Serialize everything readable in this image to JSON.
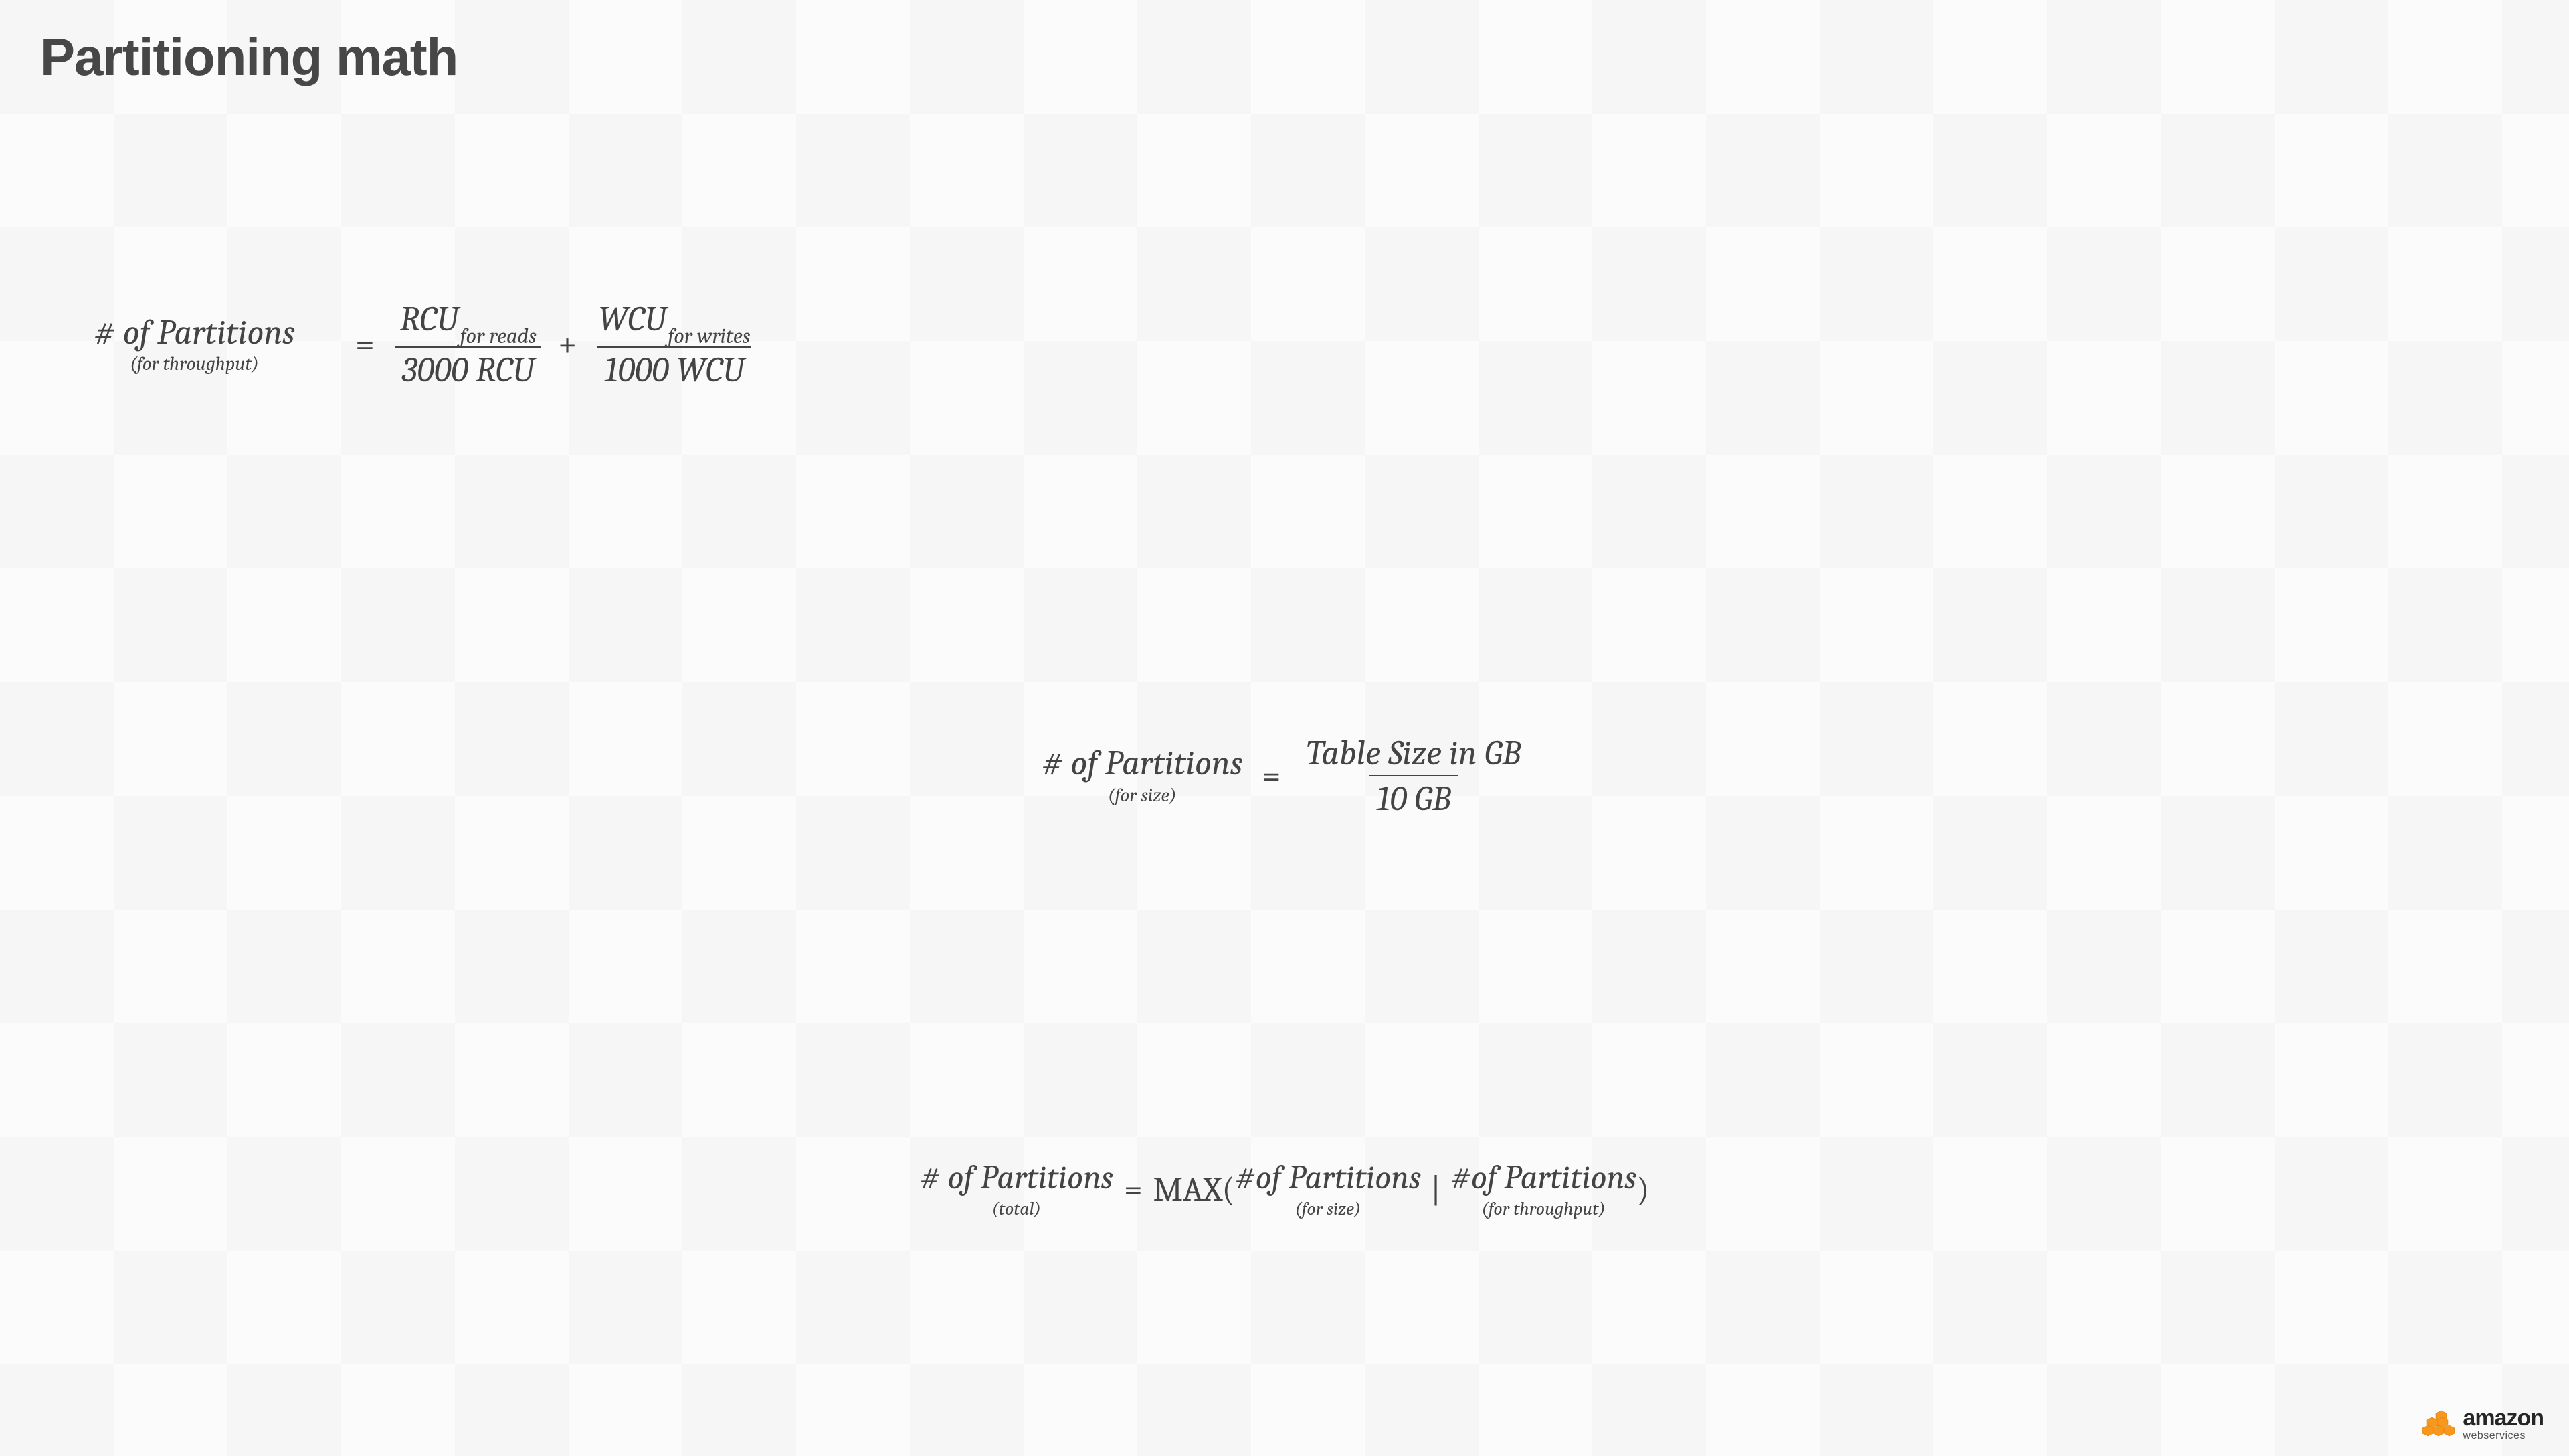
{
  "title": "Partitioning math",
  "eq1": {
    "lhs_main": "# of Partitions",
    "lhs_note": "(for throughput)",
    "frac1_num_base": "RCU",
    "frac1_num_sub": "for reads",
    "frac1_den": "3000 RCU",
    "frac2_num_base": "WCU",
    "frac2_num_sub": "for writes",
    "frac2_den": "1000 WCU"
  },
  "eq2": {
    "lhs_main": "# of Partitions",
    "lhs_note": "(for size)",
    "frac_num": "Table Size in GB",
    "frac_den": "10 GB"
  },
  "eq3": {
    "lhs_main": "# of Partitions",
    "lhs_note": "(total)",
    "fn": "MAX(",
    "arg1_main": "#of Partitions",
    "arg1_note": "(for size)",
    "arg2_main": "#of Partitions",
    "arg2_note": "(for throughput)",
    "close": ")"
  },
  "symbols": {
    "equals": "=",
    "plus": "+",
    "pipe": "|"
  },
  "logo": {
    "brand": "amazon",
    "sub": "webservices",
    "color": "#f7981d"
  }
}
